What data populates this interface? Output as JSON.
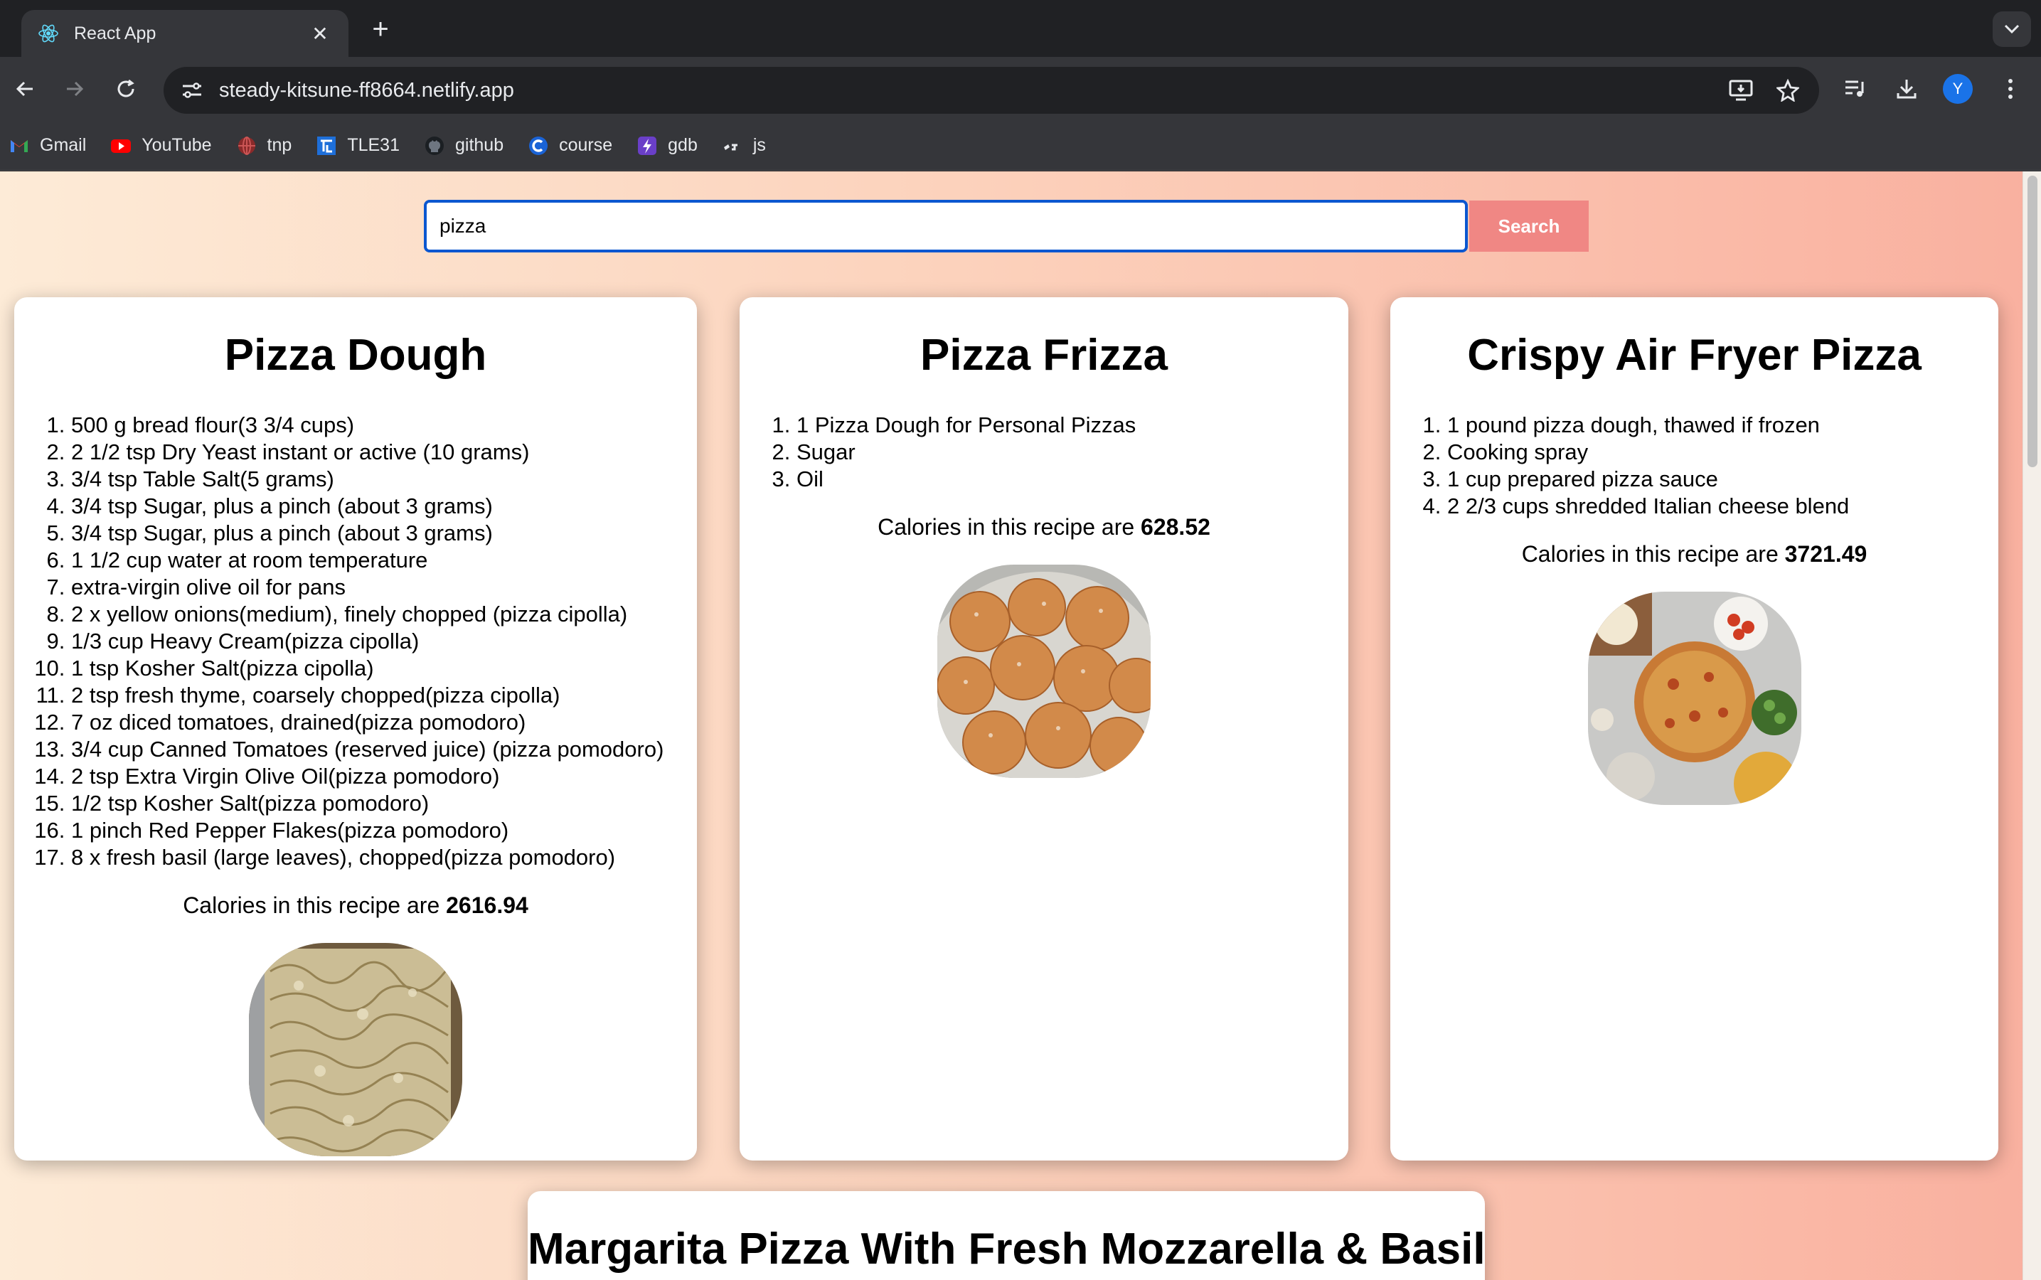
{
  "browser": {
    "tab_title": "React App",
    "url": "steady-kitsune-ff8664.netlify.app",
    "profile_initial": "Y",
    "bookmarks": [
      {
        "label": "Gmail",
        "icon": "gmail-icon"
      },
      {
        "label": "YouTube",
        "icon": "youtube-icon"
      },
      {
        "label": "tnp",
        "icon": "globe-icon"
      },
      {
        "label": "TLE31",
        "icon": "tle-icon"
      },
      {
        "label": "github",
        "icon": "github-icon"
      },
      {
        "label": "course",
        "icon": "course-icon"
      },
      {
        "label": "gdb",
        "icon": "gdb-icon"
      },
      {
        "label": "js",
        "icon": "js-icon"
      }
    ]
  },
  "search": {
    "value": "pizza",
    "button_label": "Search"
  },
  "calories_prefix": "Calories in this recipe are",
  "recipes": [
    {
      "title": "Pizza Dough",
      "ingredients": [
        "500 g bread flour(3 3/4 cups)",
        "2 1/2 tsp Dry Yeast instant or active (10 grams)",
        "3/4 tsp Table Salt(5 grams)",
        "3/4 tsp Sugar, plus a pinch (about 3 grams)",
        "3/4 tsp Sugar, plus a pinch (about 3 grams)",
        "1 1/2 cup water at room temperature",
        "extra-virgin olive oil for pans",
        "2 x yellow onions(medium), finely chopped (pizza cipolla)",
        "1/3 cup Heavy Cream(pizza cipolla)",
        "1 tsp Kosher Salt(pizza cipolla)",
        "2 tsp fresh thyme, coarsely chopped(pizza cipolla)",
        "7 oz diced tomatoes, drained(pizza pomodoro)",
        "3/4 cup Canned Tomatoes (reserved juice) (pizza pomodoro)",
        "2 tsp Extra Virgin Olive Oil(pizza pomodoro)",
        "1/2 tsp Kosher Salt(pizza pomodoro)",
        "1 pinch Red Pepper Flakes(pizza pomodoro)",
        "8 x fresh basil (large leaves), chopped(pizza pomodoro)"
      ],
      "calories": "2616.94"
    },
    {
      "title": "Pizza Frizza",
      "ingredients": [
        "1 Pizza Dough for Personal Pizzas",
        "Sugar",
        "Oil"
      ],
      "calories": "628.52"
    },
    {
      "title": "Crispy Air Fryer Pizza",
      "ingredients": [
        "1 pound pizza dough, thawed if frozen",
        "Cooking spray",
        "1 cup prepared pizza sauce",
        "2 2/3 cups shredded Italian cheese blend"
      ],
      "calories": "3721.49"
    },
    {
      "title": "Margarita Pizza With Fresh Mozzarella & Basil"
    }
  ]
}
